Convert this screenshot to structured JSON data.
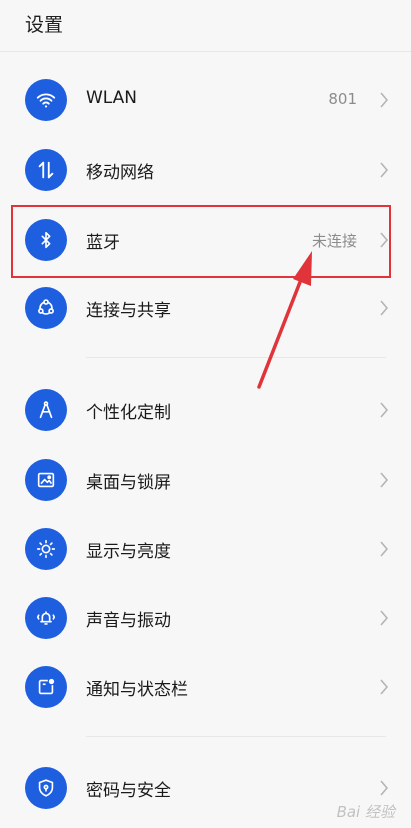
{
  "header": {
    "title": "设置"
  },
  "rows": [
    {
      "label": "WLAN",
      "value": "801",
      "icon": "wifi-icon"
    },
    {
      "label": "移动网络",
      "value": "",
      "icon": "mobile-data-icon"
    },
    {
      "label": "蓝牙",
      "value": "未连接",
      "icon": "bluetooth-icon"
    },
    {
      "label": "连接与共享",
      "value": "",
      "icon": "share-connection-icon"
    },
    {
      "label": "个性化定制",
      "value": "",
      "icon": "personalization-icon"
    },
    {
      "label": "桌面与锁屏",
      "value": "",
      "icon": "wallpaper-icon"
    },
    {
      "label": "显示与亮度",
      "value": "",
      "icon": "brightness-icon"
    },
    {
      "label": "声音与振动",
      "value": "",
      "icon": "sound-vibration-icon"
    },
    {
      "label": "通知与状态栏",
      "value": "",
      "icon": "notification-icon"
    },
    {
      "label": "密码与安全",
      "value": "",
      "icon": "security-shield-icon"
    }
  ],
  "annotation": {
    "highlight_color": "#e0343a"
  },
  "watermark": "Bai 经验",
  "colors": {
    "accent": "#1e5fe0",
    "background": "#f7f7f7"
  }
}
